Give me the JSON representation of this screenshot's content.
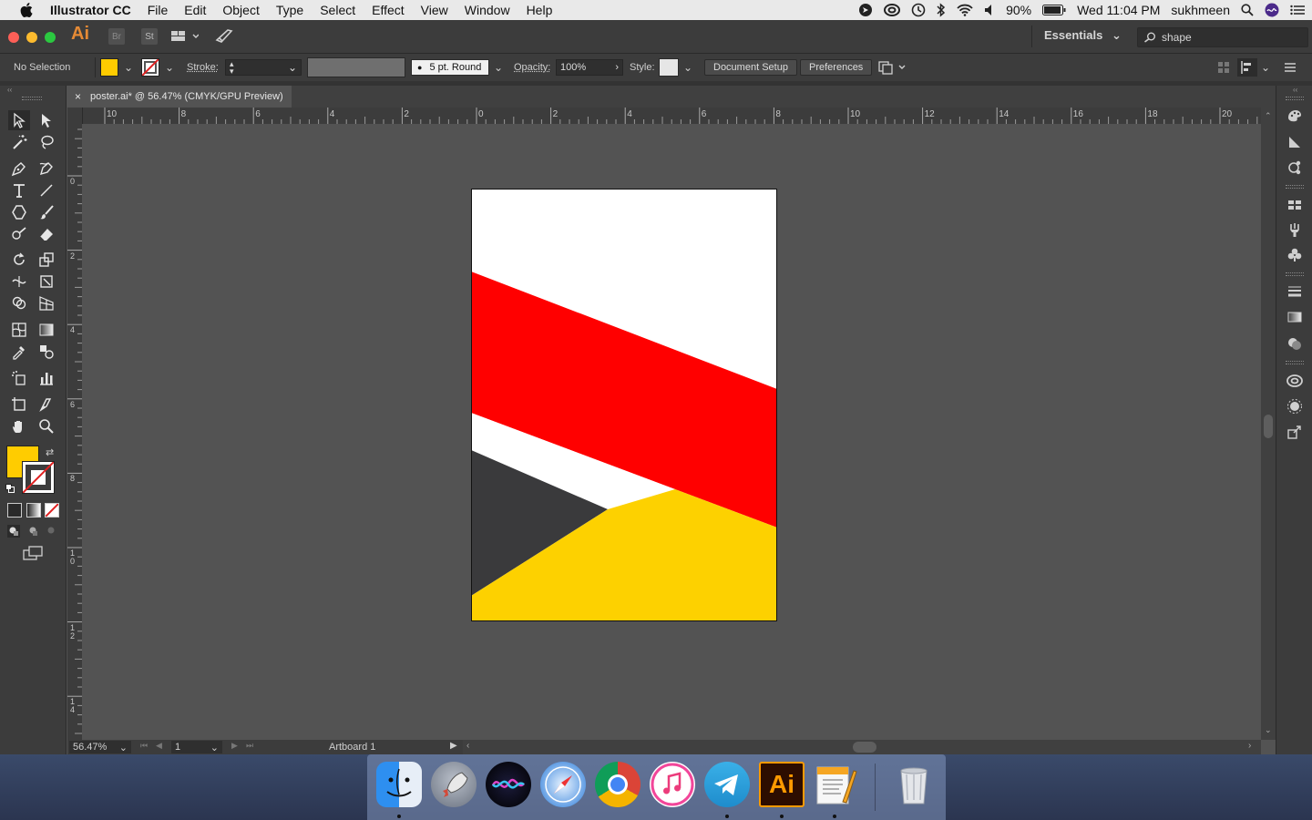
{
  "menubar": {
    "app_name": "Illustrator CC",
    "menus": [
      "File",
      "Edit",
      "Object",
      "Type",
      "Select",
      "Effect",
      "View",
      "Window",
      "Help"
    ],
    "battery": "90%",
    "datetime": "Wed 11:04 PM",
    "user": "sukhmeen"
  },
  "appbar": {
    "logo": "Ai",
    "bridge_label": "Br",
    "stock_label": "St",
    "workspace": "Essentials",
    "search_value": "shape"
  },
  "controlbar": {
    "selection_label": "No Selection",
    "fill_color": "#FFCC00",
    "stroke_label": "Stroke:",
    "brush_value": "5 pt. Round",
    "opacity_label": "Opacity:",
    "opacity_value": "100%",
    "style_label": "Style:",
    "document_setup": "Document Setup",
    "preferences": "Preferences"
  },
  "document": {
    "tab_title": "poster.ai* @ 56.47% (CMYK/GPU Preview)"
  },
  "rulers": {
    "top_labels": [
      "10",
      "8",
      "6",
      "4",
      "2",
      "0",
      "2",
      "4",
      "6",
      "8",
      "10",
      "12",
      "14",
      "16",
      "18",
      "20"
    ],
    "left_labels": [
      "0",
      "2",
      "4",
      "6",
      "8",
      "1\n0",
      "1\n2",
      "1\n4"
    ]
  },
  "statusbar": {
    "zoom": "56.47%",
    "page": "1",
    "artboard_name": "Artboard 1"
  },
  "artwork": {
    "colors": {
      "red": "#FF0000",
      "yellow": "#FDD100",
      "dark": "#3A3A3C",
      "white": "#FFFFFF"
    }
  },
  "dock": {
    "apps": [
      "finder",
      "launchpad",
      "siri",
      "safari",
      "chrome",
      "itunes",
      "telegram",
      "illustrator",
      "pages",
      "trash"
    ],
    "ai_label": "Ai"
  }
}
